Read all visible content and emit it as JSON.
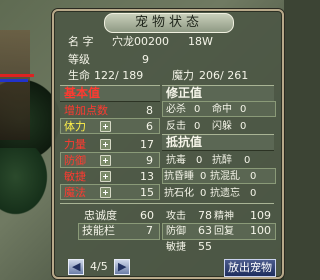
{
  "window": {
    "title": "宠物状态"
  },
  "pet": {
    "name_label": "名  字",
    "name_value": "穴龙00200",
    "name_extra": "18W",
    "level_label": "等级",
    "level_value": "9",
    "hp_label": "生命",
    "hp_value": "122/ 189",
    "mp_label": "魔力",
    "mp_value": "206/ 261"
  },
  "basic": {
    "header": "基本值",
    "add_points_label": "增加点数",
    "add_points_value": "8",
    "rows": [
      {
        "label": "体力",
        "value": "6"
      },
      {
        "label": "力量",
        "value": "17"
      },
      {
        "label": "防御",
        "value": "9"
      },
      {
        "label": "敏捷",
        "value": "13"
      },
      {
        "label": "魔法",
        "value": "15"
      }
    ]
  },
  "correction": {
    "header": "修正值",
    "rows": [
      {
        "l1": "必杀",
        "v1": "0",
        "l2": "命中",
        "v2": "0"
      },
      {
        "l1": "反击",
        "v1": "0",
        "l2": "闪躲",
        "v2": "0"
      }
    ]
  },
  "resistance": {
    "header": "抵抗值",
    "rows": [
      {
        "l1": "抗毒",
        "v1": "0",
        "l2": "抗醉",
        "v2": "0"
      },
      {
        "l1": "抗昏睡",
        "v1": "0",
        "l2": "抗混乱",
        "v2": "0"
      },
      {
        "l1": "抗石化",
        "v1": "0",
        "l2": "抗遗忘",
        "v2": "0"
      }
    ]
  },
  "lower": {
    "loyalty_label": "忠诚度",
    "loyalty_value": "60",
    "skill_label": "技能栏",
    "skill_value": "7",
    "attack_label": "攻击",
    "attack_value": "78",
    "spirit_label": "精神",
    "spirit_value": "109",
    "defense_label": "防御",
    "defense_value": "63",
    "recovery_label": "回复",
    "recovery_value": "100",
    "agility_label": "敏捷",
    "agility_value": "55"
  },
  "footer": {
    "page": "4/5",
    "release_button": "放出宠物"
  },
  "colors": {
    "red_label": "#ff3a30",
    "yellow_label": "#fff04a",
    "panel_bg": "#4e5846"
  }
}
